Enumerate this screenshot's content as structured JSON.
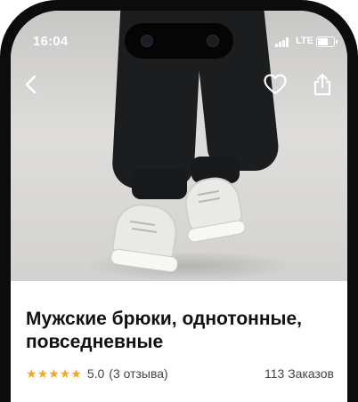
{
  "status_bar": {
    "time": "16:04",
    "network": "LTE",
    "battery_level": 0.7
  },
  "nav": {
    "back_icon": "chevron-left-icon",
    "favorite_icon": "heart-icon",
    "share_icon": "share-icon"
  },
  "hero": {
    "subject": "product-photo"
  },
  "product": {
    "title": "Мужские брюки, однотонные, повседневные",
    "rating": "5.0",
    "stars": 5,
    "reviews": "(3 отзыва)",
    "orders": "113 Заказов",
    "star_color": "#f5a623"
  }
}
